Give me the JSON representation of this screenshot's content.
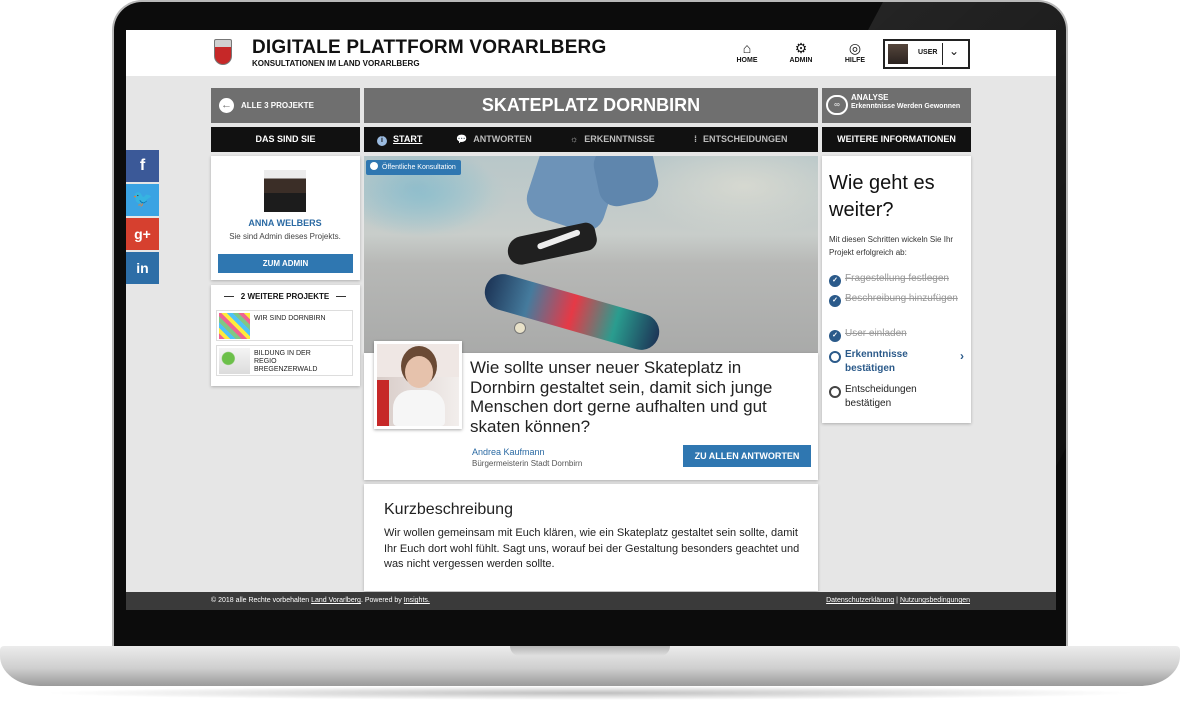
{
  "header": {
    "title": "DIGITALE PLATTFORM VORARLBERG",
    "subtitle": "KONSULTATIONEN IM LAND VORARLBERG",
    "nav": [
      {
        "label": "HOME",
        "icon": "home-icon"
      },
      {
        "label": "ADMIN",
        "icon": "gear-icon"
      },
      {
        "label": "HILFE",
        "icon": "help-icon"
      }
    ],
    "user_label": "USER"
  },
  "subheader": {
    "back_label": "ALLE 3 PROJEKTE",
    "project_title": "SKATEPLATZ DORNBIRN",
    "analyse_title": "ANALYSE",
    "analyse_sub": "Erkenntnisse Werden Gewonnen"
  },
  "tabs": {
    "left_heading": "DAS SIND SIE",
    "right_heading": "WEITERE INFORMATIONEN",
    "items": [
      {
        "label": "START",
        "icon": "info-icon",
        "active": true
      },
      {
        "label": "ANTWORTEN",
        "icon": "speech-bubble-icon",
        "active": false
      },
      {
        "label": "ERKENNTNISSE",
        "icon": "lightbulb-icon",
        "active": false
      },
      {
        "label": "ENTSCHEIDUNGEN",
        "icon": "bulb-outline-icon",
        "active": false
      }
    ]
  },
  "social": [
    {
      "label": "f",
      "icon": "facebook-icon",
      "color": "#3b5998"
    },
    {
      "label": "t",
      "icon": "twitter-icon",
      "color": "#3aa3e3"
    },
    {
      "label": "g+",
      "icon": "google-plus-icon",
      "color": "#d6402f"
    },
    {
      "label": "in",
      "icon": "linkedin-icon",
      "color": "#2d6ea7"
    }
  ],
  "profile": {
    "name": "ANNA WELBERS",
    "role": "Sie sind Admin dieses Projekts.",
    "button": "ZUM ADMIN"
  },
  "more_projects": {
    "heading": "2 WEITERE PROJEKTE",
    "items": [
      {
        "label": "WIR SIND DORNBIRN"
      },
      {
        "label": "BILDUNG IN DER REGIO BREGENZERWALD"
      }
    ]
  },
  "hero": {
    "badge": "Öffentliche Konsultation"
  },
  "question": {
    "text": "Wie sollte unser neuer Skateplatz in Dornbirn gestaltet sein, damit sich junge Menschen dort gerne aufhalten und gut skaten können?",
    "author_name": "Andrea Kaufmann",
    "author_role": "Bürgermeisterin Stadt Dornbirn",
    "button": "ZU ALLEN ANTWORTEN"
  },
  "summary": {
    "heading": "Kurzbeschreibung",
    "text": "Wir wollen gemeinsam mit Euch klären, wie ein Skateplatz gestaltet sein sollte, damit Ihr Euch dort wohl fühlt. Sagt uns, worauf bei der Gestaltung besonders geachtet und was nicht vergessen werden sollte."
  },
  "next_steps": {
    "heading": "Wie geht es weiter?",
    "intro": "Mit diesen Schritten wickeln Sie Ihr Projekt erfolgreich ab:",
    "steps": [
      {
        "label": "Fragestellung festlegen",
        "state": "done"
      },
      {
        "label": "Beschreibung hinzufügen",
        "state": "done"
      },
      {
        "label": "User einladen",
        "state": "done"
      },
      {
        "label": "Erkenntnisse bestätigen",
        "state": "current"
      },
      {
        "label": "Entscheidungen bestätigen",
        "state": "todo"
      }
    ]
  },
  "footer": {
    "copyright_prefix": "© 2018 alle Rechte vorbehalten",
    "copyright_link": "Land Vorarlberg",
    "powered_prefix": ". Powered by",
    "powered_link": "Insights.",
    "privacy": "Datenschutzerklärung",
    "separator": "|",
    "terms": "Nutzungsbedingungen"
  }
}
